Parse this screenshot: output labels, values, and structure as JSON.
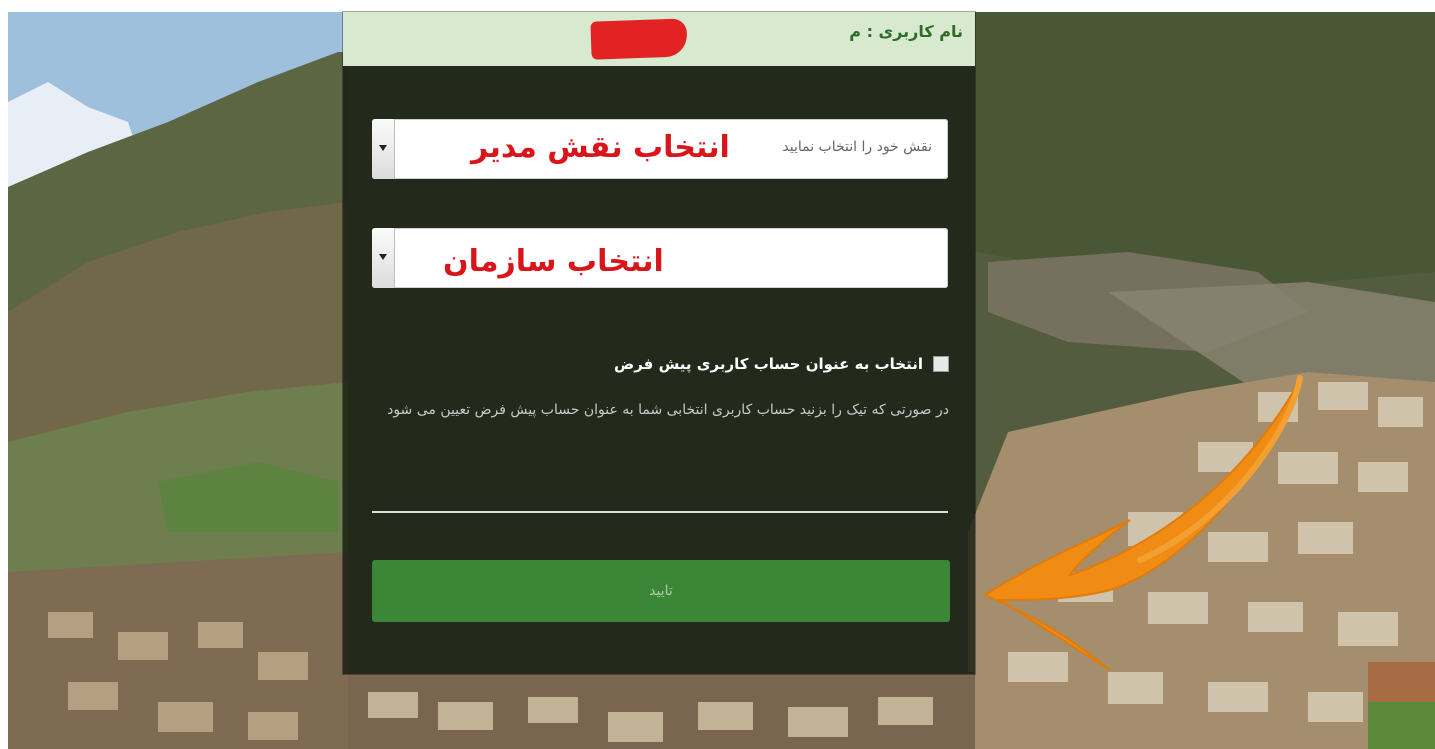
{
  "header": {
    "username_label": "نام کاربری : م"
  },
  "role_select": {
    "placeholder": "نقش خود را انتخاب نمایید",
    "overlay_label": "انتخاب نقش مدیر"
  },
  "org_select": {
    "overlay_label": "انتخاب سازمان"
  },
  "default_account": {
    "checkbox_label": "انتخاب به عنوان حساب کاربری پیش فرض",
    "help_text": "در صورتی که تیک را بزنید حساب کاربری انتخابی شما به عنوان حساب پیش فرض تعیین می شود"
  },
  "submit": {
    "label": "تایید"
  },
  "colors": {
    "header_bg": "#d7e9cf",
    "panel_bg": "#141a12",
    "submit_bg": "#3f8f3a",
    "annotation_red": "#d9141b",
    "arrow_orange": "#f08c14"
  },
  "icons": {
    "role_dropdown": "chevron-down-icon",
    "org_dropdown": "chevron-down-icon",
    "annotation": "curved-arrow-icon"
  }
}
